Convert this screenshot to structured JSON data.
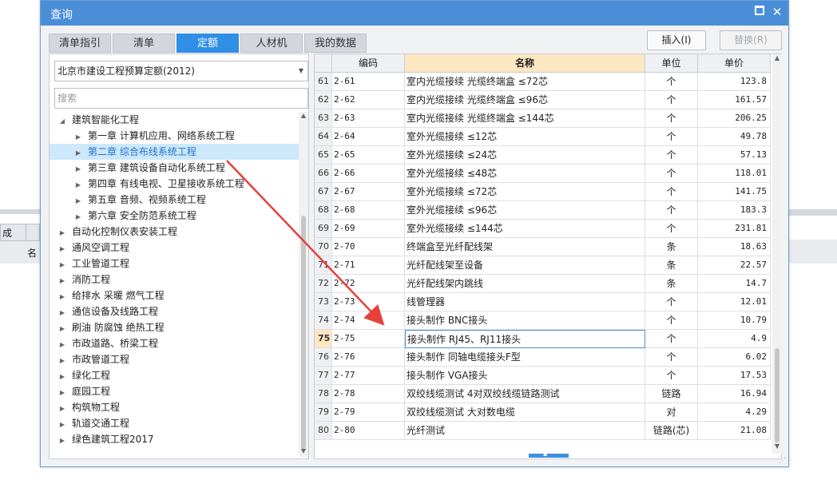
{
  "background": {
    "tab_label": "成",
    "column_label": "名"
  },
  "dialog": {
    "title": "查询",
    "maximize_icon": "maximize-icon",
    "close_icon": "close-icon",
    "close_glyph": "✕"
  },
  "tabs": [
    {
      "label": "清单指引"
    },
    {
      "label": "清单"
    },
    {
      "label": "定额",
      "active": true
    },
    {
      "label": "人材机"
    },
    {
      "label": "我的数据"
    }
  ],
  "buttons": {
    "insert": "插入(I)",
    "replace": "替换(R)"
  },
  "quota_select": {
    "value": "北京市建设工程预算定额(2012)"
  },
  "search": {
    "placeholder": "搜索"
  },
  "tree": [
    {
      "label": "建筑智能化工程",
      "level": 0,
      "expanded": true
    },
    {
      "label": "第一章 计算机应用、网络系统工程",
      "level": 1
    },
    {
      "label": "第二章 综合布线系统工程",
      "level": 1,
      "selected": true
    },
    {
      "label": "第三章 建筑设备自动化系统工程",
      "level": 1
    },
    {
      "label": "第四章 有线电视、卫星接收系统工程",
      "level": 1
    },
    {
      "label": "第五章 音频、视频系统工程",
      "level": 1
    },
    {
      "label": "第六章 安全防范系统工程",
      "level": 1
    },
    {
      "label": "自动化控制仪表安装工程",
      "level": 0
    },
    {
      "label": "通风空调工程",
      "level": 0
    },
    {
      "label": "工业管道工程",
      "level": 0
    },
    {
      "label": "消防工程",
      "level": 0
    },
    {
      "label": "给排水 采暖 燃气工程",
      "level": 0
    },
    {
      "label": "通信设备及线路工程",
      "level": 0
    },
    {
      "label": "刷油 防腐蚀 绝热工程",
      "level": 0
    },
    {
      "label": "市政道路、桥梁工程",
      "level": 0
    },
    {
      "label": "市政管道工程",
      "level": 0
    },
    {
      "label": "绿化工程",
      "level": 0
    },
    {
      "label": "庭园工程",
      "level": 0
    },
    {
      "label": "构筑物工程",
      "level": 0
    },
    {
      "label": "轨道交通工程",
      "level": 0
    },
    {
      "label": "绿色建筑工程2017",
      "level": 0
    }
  ],
  "table": {
    "headers": {
      "code": "编码",
      "name": "名称",
      "unit": "单位",
      "price": "单价"
    },
    "rows": [
      {
        "idx": "61",
        "code": "2-61",
        "name": "室内光缆接续 光缆终端盒 ≤72芯",
        "unit": "个",
        "price": "123.8"
      },
      {
        "idx": "62",
        "code": "2-62",
        "name": "室内光缆接续 光缆终端盒 ≤96芯",
        "unit": "个",
        "price": "161.57"
      },
      {
        "idx": "63",
        "code": "2-63",
        "name": "室内光缆接续 光缆终端盒 ≤144芯",
        "unit": "个",
        "price": "206.25"
      },
      {
        "idx": "64",
        "code": "2-64",
        "name": "室外光缆接续 ≤12芯",
        "unit": "个",
        "price": "49.78"
      },
      {
        "idx": "65",
        "code": "2-65",
        "name": "室外光缆接续 ≤24芯",
        "unit": "个",
        "price": "57.13"
      },
      {
        "idx": "66",
        "code": "2-66",
        "name": "室外光缆接续 ≤48芯",
        "unit": "个",
        "price": "118.01"
      },
      {
        "idx": "67",
        "code": "2-67",
        "name": "室外光缆接续 ≤72芯",
        "unit": "个",
        "price": "141.75"
      },
      {
        "idx": "68",
        "code": "2-68",
        "name": "室外光缆接续 ≤96芯",
        "unit": "个",
        "price": "183.3"
      },
      {
        "idx": "69",
        "code": "2-69",
        "name": "室外光缆接续 ≤144芯",
        "unit": "个",
        "price": "231.81"
      },
      {
        "idx": "70",
        "code": "2-70",
        "name": "终端盒至光纤配线架",
        "unit": "条",
        "price": "18.63"
      },
      {
        "idx": "71",
        "code": "2-71",
        "name": "光纤配线架至设备",
        "unit": "条",
        "price": "22.57"
      },
      {
        "idx": "72",
        "code": "2-72",
        "name": "光纤配线架内跳线",
        "unit": "条",
        "price": "14.7"
      },
      {
        "idx": "73",
        "code": "2-73",
        "name": "线管理器",
        "unit": "个",
        "price": "12.01"
      },
      {
        "idx": "74",
        "code": "2-74",
        "name": "接头制作 BNC接头",
        "unit": "个",
        "price": "10.79"
      },
      {
        "idx": "75",
        "code": "2-75",
        "name": "接头制作 RJ45、RJ11接头",
        "unit": "个",
        "price": "4.9",
        "current": true
      },
      {
        "idx": "76",
        "code": "2-76",
        "name": "接头制作 同轴电缆接头F型",
        "unit": "个",
        "price": "6.02"
      },
      {
        "idx": "77",
        "code": "2-77",
        "name": "接头制作 VGA接头",
        "unit": "个",
        "price": "17.53"
      },
      {
        "idx": "78",
        "code": "2-78",
        "name": "双绞线缆测试 4对双绞线缆链路测试",
        "unit": "链路",
        "price": "16.94"
      },
      {
        "idx": "79",
        "code": "2-79",
        "name": "双绞线缆测试 大对数电缆",
        "unit": "对",
        "price": "4.29"
      },
      {
        "idx": "80",
        "code": "2-80",
        "name": "光纤测试",
        "unit": "链路(芯)",
        "price": "21.08"
      }
    ]
  },
  "annotation": {
    "color": "#e8403a"
  }
}
